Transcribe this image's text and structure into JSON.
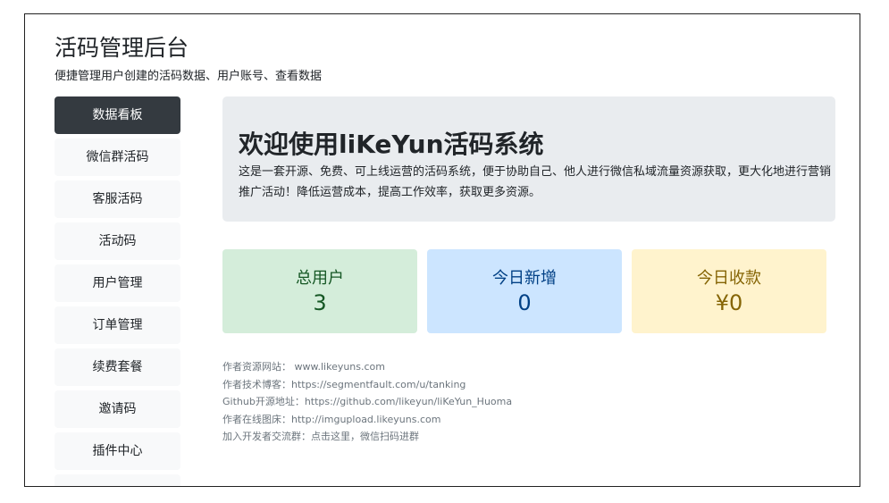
{
  "header": {
    "title": "活码管理后台",
    "subtitle": "便捷管理用户创建的活码数据、用户账号、查看数据"
  },
  "sidebar": {
    "items": [
      {
        "label": "数据看板",
        "active": true
      },
      {
        "label": "微信群活码",
        "active": false
      },
      {
        "label": "客服活码",
        "active": false
      },
      {
        "label": "活动码",
        "active": false
      },
      {
        "label": "用户管理",
        "active": false
      },
      {
        "label": "订单管理",
        "active": false
      },
      {
        "label": "续费套餐",
        "active": false
      },
      {
        "label": "邀请码",
        "active": false
      },
      {
        "label": "插件中心",
        "active": false
      }
    ]
  },
  "welcome": {
    "title": "欢迎使用liKeYun活码系统",
    "description": "这是一套开源、免费、可上线运营的活码系统，便于协助自己、他人进行微信私域流量资源获取，更大化地进行营销推广活动！降低运营成本，提高工作效率，获取更多资源。"
  },
  "stats": {
    "users": {
      "label": "总用户",
      "value": "3"
    },
    "new_today": {
      "label": "今日新增",
      "value": "0"
    },
    "income_today": {
      "label": "今日收款",
      "value": "¥0"
    }
  },
  "info": [
    "作者资源网站：  www.likeyuns.com",
    "作者技术博客：https://segmentfault.com/u/tanking",
    "Github开源地址：https://github.com/likeyun/liKeYun_Huoma",
    "作者在线图床：http://imgupload.likeyuns.com",
    "加入开发者交流群：点击这里，微信扫码进群"
  ],
  "colors": {
    "active_nav_bg": "#343a40",
    "nav_bg": "#f8f9fa",
    "jumbotron_bg": "#e9ecef",
    "users_card_bg": "#d4edda",
    "new_card_bg": "#cce5ff",
    "income_card_bg": "#fff3cd"
  }
}
